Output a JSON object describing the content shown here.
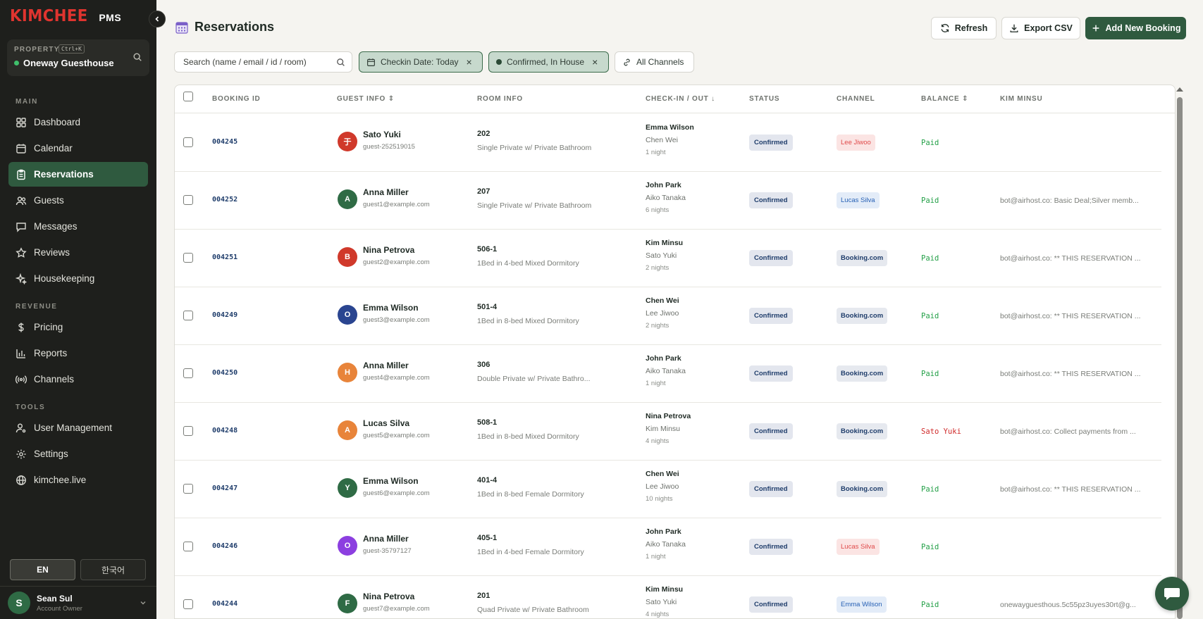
{
  "app": {
    "brand": "KIMCHEE",
    "product": "PMS"
  },
  "property": {
    "label": "PROPERTY",
    "shortcut": "Ctrl+K",
    "name": "Oneway Guesthouse"
  },
  "sidebar": {
    "sections": {
      "main": "MAIN",
      "revenue": "REVENUE",
      "tools": "TOOLS"
    },
    "items": [
      {
        "label": "Dashboard",
        "icon": "grid-icon"
      },
      {
        "label": "Calendar",
        "icon": "calendar-icon"
      },
      {
        "label": "Reservations",
        "icon": "clipboard-icon",
        "active": true
      },
      {
        "label": "Guests",
        "icon": "users-icon"
      },
      {
        "label": "Messages",
        "icon": "message-icon"
      },
      {
        "label": "Reviews",
        "icon": "star-icon"
      },
      {
        "label": "Housekeeping",
        "icon": "sparkle-icon"
      },
      {
        "label": "Pricing",
        "icon": "dollar-icon"
      },
      {
        "label": "Reports",
        "icon": "bar-chart-icon"
      },
      {
        "label": "Channels",
        "icon": "broadcast-icon"
      },
      {
        "label": "User Management",
        "icon": "user-cog-icon"
      },
      {
        "label": "Settings",
        "icon": "gear-icon"
      },
      {
        "label": "kimchee.live",
        "icon": "globe-icon"
      }
    ],
    "languages": [
      "EN",
      "한국어"
    ],
    "user": {
      "initial": "S",
      "name": "Sean Sul",
      "role": "Account Owner"
    }
  },
  "header": {
    "title": "Reservations",
    "refresh_label": "Refresh",
    "export_label": "Export CSV",
    "add_label": "Add New Booking"
  },
  "filters": {
    "search_placeholder": "Search (name / email / id / room)",
    "checkin_chip": "Checkin Date: Today",
    "status_chip": "Confirmed, In House",
    "channels_chip": "All Channels"
  },
  "table": {
    "headers": [
      "BOOKING ID",
      "GUEST INFO",
      "ROOM INFO",
      "CHECK-IN / OUT",
      "STATUS",
      "CHANNEL",
      "BALANCE",
      "KIM MINSU"
    ],
    "rows": [
      {
        "id": "004245",
        "initial": "于",
        "avatar_color": "#d0392b",
        "guest": "Sato Yuki",
        "guest_sub": "guest-252519015",
        "room": "202",
        "room_desc": "Single Private w/ Private Bathroom",
        "c1": "Emma Wilson",
        "c2": "Chen Wei",
        "c3": "1 night",
        "status": "Confirmed",
        "channel": "Lee Jiwoo",
        "channel_style": "red",
        "balance": "Paid",
        "balance_style": "green",
        "note": ""
      },
      {
        "id": "004252",
        "initial": "A",
        "avatar_color": "#2f6b45",
        "guest": "Anna Miller",
        "guest_sub": "guest1@example.com",
        "room": "207",
        "room_desc": "Single Private w/ Private Bathroom",
        "c1": "John Park",
        "c2": "Aiko Tanaka",
        "c3": "6 nights",
        "status": "Confirmed",
        "channel": "Lucas Silva",
        "channel_style": "blue",
        "balance": "Paid",
        "balance_style": "green",
        "note": "bot@airhost.co: Basic Deal;Silver memb..."
      },
      {
        "id": "004251",
        "initial": "B",
        "avatar_color": "#d0392b",
        "guest": "Nina Petrova",
        "guest_sub": "guest2@example.com",
        "room": "506-1",
        "room_desc": "1Bed in 4-bed Mixed Dormitory",
        "c1": "Kim Minsu",
        "c2": "Sato Yuki",
        "c3": "2 nights",
        "status": "Confirmed",
        "channel": "Booking.com",
        "channel_style": "bk",
        "balance": "Paid",
        "balance_style": "green",
        "note": "bot@airhost.co: ** THIS RESERVATION ..."
      },
      {
        "id": "004249",
        "initial": "O",
        "avatar_color": "#2a4590",
        "guest": "Emma Wilson",
        "guest_sub": "guest3@example.com",
        "room": "501-4",
        "room_desc": "1Bed in 8-bed Mixed Dormitory",
        "c1": "Chen Wei",
        "c2": "Lee Jiwoo",
        "c3": "2 nights",
        "status": "Confirmed",
        "channel": "Booking.com",
        "channel_style": "bk",
        "balance": "Paid",
        "balance_style": "green",
        "note": "bot@airhost.co: ** THIS RESERVATION ..."
      },
      {
        "id": "004250",
        "initial": "H",
        "avatar_color": "#e8843a",
        "guest": "Anna Miller",
        "guest_sub": "guest4@example.com",
        "room": "306",
        "room_desc": "Double Private w/ Private Bathro...",
        "c1": "John Park",
        "c2": "Aiko Tanaka",
        "c3": "1 night",
        "status": "Confirmed",
        "channel": "Booking.com",
        "channel_style": "bk",
        "balance": "Paid",
        "balance_style": "green",
        "note": "bot@airhost.co: ** THIS RESERVATION ..."
      },
      {
        "id": "004248",
        "initial": "A",
        "avatar_color": "#e8843a",
        "guest": "Lucas Silva",
        "guest_sub": "guest5@example.com",
        "room": "508-1",
        "room_desc": "1Bed in 8-bed Mixed Dormitory",
        "c1": "Nina Petrova",
        "c2": "Kim Minsu",
        "c3": "4 nights",
        "status": "Confirmed",
        "channel": "Booking.com",
        "channel_style": "bk",
        "balance": "Sato Yuki",
        "balance_style": "red",
        "note": "bot@airhost.co: Collect payments from ..."
      },
      {
        "id": "004247",
        "initial": "Y",
        "avatar_color": "#2f6b45",
        "guest": "Emma Wilson",
        "guest_sub": "guest6@example.com",
        "room": "401-4",
        "room_desc": "1Bed in 8-bed Female Dormitory",
        "c1": "Chen Wei",
        "c2": "Lee Jiwoo",
        "c3": "10 nights",
        "status": "Confirmed",
        "channel": "Booking.com",
        "channel_style": "bk",
        "balance": "Paid",
        "balance_style": "green",
        "note": "bot@airhost.co: ** THIS RESERVATION ..."
      },
      {
        "id": "004246",
        "initial": "O",
        "avatar_color": "#8c3fe0",
        "guest": "Anna Miller",
        "guest_sub": "guest-35797127",
        "room": "405-1",
        "room_desc": "1Bed in 4-bed Female Dormitory",
        "c1": "John Park",
        "c2": "Aiko Tanaka",
        "c3": "1 night",
        "status": "Confirmed",
        "channel": "Lucas Silva",
        "channel_style": "red",
        "balance": "Paid",
        "balance_style": "green",
        "note": ""
      },
      {
        "id": "004244",
        "initial": "F",
        "avatar_color": "#2f6b45",
        "guest": "Nina Petrova",
        "guest_sub": "guest7@example.com",
        "room": "201",
        "room_desc": "Quad Private w/ Private Bathroom",
        "c1": "Kim Minsu",
        "c2": "Sato Yuki",
        "c3": "4 nights",
        "status": "Confirmed",
        "channel": "Emma Wilson",
        "channel_style": "blue",
        "balance": "Paid",
        "balance_style": "green",
        "note": "onewayguesthous.5c55pz3uyes30rt@g..."
      }
    ]
  }
}
